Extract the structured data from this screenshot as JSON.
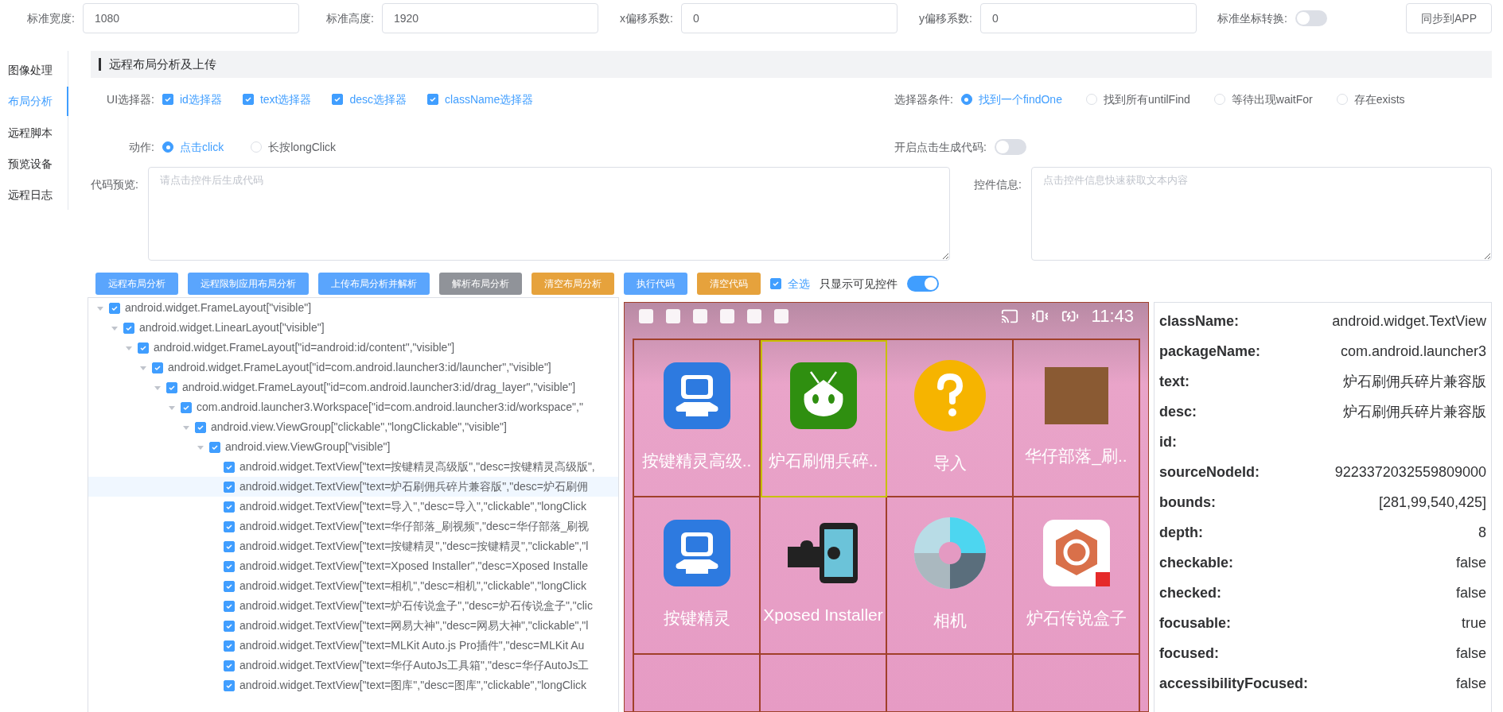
{
  "top_bar": {
    "fields": [
      {
        "label": "标准宽度:",
        "value": "1080"
      },
      {
        "label": "标准高度:",
        "value": "1920"
      },
      {
        "label": "x偏移系数:",
        "value": "0"
      },
      {
        "label": "y偏移系数:",
        "value": "0"
      }
    ],
    "toggle": {
      "label": "标准坐标转换:",
      "on": false
    },
    "button": "同步到APP"
  },
  "sidebar": {
    "items": [
      {
        "label": "图像处理",
        "selected": false
      },
      {
        "label": "布局分析",
        "selected": true
      },
      {
        "label": "远程脚本",
        "selected": false
      },
      {
        "label": "预览设备",
        "selected": false
      },
      {
        "label": "远程日志",
        "selected": false
      }
    ]
  },
  "section_title": "远程布局分析及上传",
  "ui_selector": {
    "label": "UI选择器:",
    "options": [
      {
        "label": "id选择器",
        "checked": true
      },
      {
        "label": "text选择器",
        "checked": true
      },
      {
        "label": "desc选择器",
        "checked": true
      },
      {
        "label": "className选择器",
        "checked": true
      }
    ]
  },
  "selector_condition": {
    "label": "选择器条件:",
    "options": [
      {
        "label": "找到一个findOne",
        "selected": true
      },
      {
        "label": "找到所有untilFind",
        "selected": false
      },
      {
        "label": "等待出现waitFor",
        "selected": false
      },
      {
        "label": "存在exists",
        "selected": false
      }
    ]
  },
  "action": {
    "label": "动作:",
    "options": [
      {
        "label": "点击click",
        "selected": true
      },
      {
        "label": "长按longClick",
        "selected": false
      }
    ]
  },
  "generate_toggle": {
    "label": "开启点击生成代码:",
    "on": false
  },
  "code_preview": {
    "label": "代码预览:",
    "placeholder": "请点击控件后生成代码"
  },
  "widget_info": {
    "label": "控件信息:",
    "placeholder": "点击控件信息快速获取文本内容"
  },
  "buttons": [
    {
      "label": "远程布局分析",
      "kind": "primary"
    },
    {
      "label": "远程限制应用布局分析",
      "kind": "primary"
    },
    {
      "label": "上传布局分析并解析",
      "kind": "primary"
    },
    {
      "label": "解析布局分析",
      "kind": "gray"
    },
    {
      "label": "清空布局分析",
      "kind": "warning"
    },
    {
      "label": "执行代码",
      "kind": "primary"
    },
    {
      "label": "清空代码",
      "kind": "warning"
    }
  ],
  "select_all": {
    "label": "全选",
    "checked": true
  },
  "visible_only": {
    "label": "只显示可见控件",
    "on": true
  },
  "tree": [
    {
      "label": "android.widget.FrameLayout[\"visible\"]",
      "checked": true,
      "expanded": true,
      "selected": false,
      "children": [
        {
          "label": "android.widget.LinearLayout[\"visible\"]",
          "checked": true,
          "expanded": true,
          "selected": false,
          "children": [
            {
              "label": "android.widget.FrameLayout[\"id=android:id/content\",\"visible\"]",
              "checked": true,
              "expanded": true,
              "selected": false,
              "children": [
                {
                  "label": "android.widget.FrameLayout[\"id=com.android.launcher3:id/launcher\",\"visible\"]",
                  "checked": true,
                  "expanded": true,
                  "selected": false,
                  "children": [
                    {
                      "label": "android.widget.FrameLayout[\"id=com.android.launcher3:id/drag_layer\",\"visible\"]",
                      "checked": true,
                      "expanded": true,
                      "selected": false,
                      "children": [
                        {
                          "label": "com.android.launcher3.Workspace[\"id=com.android.launcher3:id/workspace\",\"",
                          "checked": true,
                          "expanded": true,
                          "selected": false,
                          "children": [
                            {
                              "label": "android.view.ViewGroup[\"clickable\",\"longClickable\",\"visible\"]",
                              "checked": true,
                              "expanded": true,
                              "selected": false,
                              "children": [
                                {
                                  "label": "android.view.ViewGroup[\"visible\"]",
                                  "checked": true,
                                  "expanded": true,
                                  "selected": false,
                                  "children": [
                                    {
                                      "label": "android.widget.TextView[\"text=按键精灵高级版\",\"desc=按键精灵高级版\",",
                                      "checked": true,
                                      "selected": false
                                    },
                                    {
                                      "label": "android.widget.TextView[\"text=炉石刷佣兵碎片兼容版\",\"desc=炉石刷佣",
                                      "checked": true,
                                      "selected": true
                                    },
                                    {
                                      "label": "android.widget.TextView[\"text=导入\",\"desc=导入\",\"clickable\",\"longClick",
                                      "checked": true,
                                      "selected": false
                                    },
                                    {
                                      "label": "android.widget.TextView[\"text=华仔部落_刷视频\",\"desc=华仔部落_刷视",
                                      "checked": true,
                                      "selected": false
                                    },
                                    {
                                      "label": "android.widget.TextView[\"text=按键精灵\",\"desc=按键精灵\",\"clickable\",\"l",
                                      "checked": true,
                                      "selected": false
                                    },
                                    {
                                      "label": "android.widget.TextView[\"text=Xposed Installer\",\"desc=Xposed Installe",
                                      "checked": true,
                                      "selected": false
                                    },
                                    {
                                      "label": "android.widget.TextView[\"text=相机\",\"desc=相机\",\"clickable\",\"longClick",
                                      "checked": true,
                                      "selected": false
                                    },
                                    {
                                      "label": "android.widget.TextView[\"text=炉石传说盒子\",\"desc=炉石传说盒子\",\"clic",
                                      "checked": true,
                                      "selected": false
                                    },
                                    {
                                      "label": "android.widget.TextView[\"text=网易大神\",\"desc=网易大神\",\"clickable\",\"l",
                                      "checked": true,
                                      "selected": false
                                    },
                                    {
                                      "label": "android.widget.TextView[\"text=MLKit Auto.js Pro插件\",\"desc=MLKit Au",
                                      "checked": true,
                                      "selected": false
                                    },
                                    {
                                      "label": "android.widget.TextView[\"text=华仔AutoJs工具箱\",\"desc=华仔AutoJs工",
                                      "checked": true,
                                      "selected": false
                                    },
                                    {
                                      "label": "android.widget.TextView[\"text=图库\",\"desc=图库\",\"clickable\",\"longClick",
                                      "checked": true,
                                      "selected": false
                                    }
                                  ]
                                }
                              ]
                            }
                          ]
                        }
                      ]
                    }
                  ]
                }
              ]
            }
          ]
        }
      ]
    }
  ],
  "phone": {
    "time": "11:43",
    "apps": [
      {
        "label": "按键精灵高级..",
        "kind": "robot",
        "selected": false
      },
      {
        "label": "炉石刷佣兵碎..",
        "kind": "bug",
        "selected": true
      },
      {
        "label": "导入",
        "kind": "question",
        "selected": false
      },
      {
        "label": "华仔部落_刷..",
        "kind": "picture",
        "selected": false
      },
      {
        "label": "按键精灵",
        "kind": "robot",
        "selected": false
      },
      {
        "label": "Xposed Installer",
        "kind": "puzzle",
        "selected": false
      },
      {
        "label": "相机",
        "kind": "aperture",
        "selected": false
      },
      {
        "label": "炉石传说盒子",
        "kind": "hexagon",
        "selected": false
      }
    ]
  },
  "info": [
    {
      "key": "className:",
      "value": "android.widget.TextView"
    },
    {
      "key": "packageName:",
      "value": "com.android.launcher3"
    },
    {
      "key": "text:",
      "value": "炉石刷佣兵碎片兼容版"
    },
    {
      "key": "desc:",
      "value": "炉石刷佣兵碎片兼容版"
    },
    {
      "key": "id:"
    },
    {
      "key": "sourceNodeId:",
      "value": "9223372032559809000"
    },
    {
      "key": "bounds:",
      "value": "[281,99,540,425]"
    },
    {
      "key": "depth:",
      "value": "8"
    },
    {
      "key": "checkable:",
      "value": "false"
    },
    {
      "key": "checked:",
      "value": "false"
    },
    {
      "key": "focusable:",
      "value": "true"
    },
    {
      "key": "focused:",
      "value": "false"
    },
    {
      "key": "accessibilityFocused:",
      "value": "false"
    }
  ]
}
